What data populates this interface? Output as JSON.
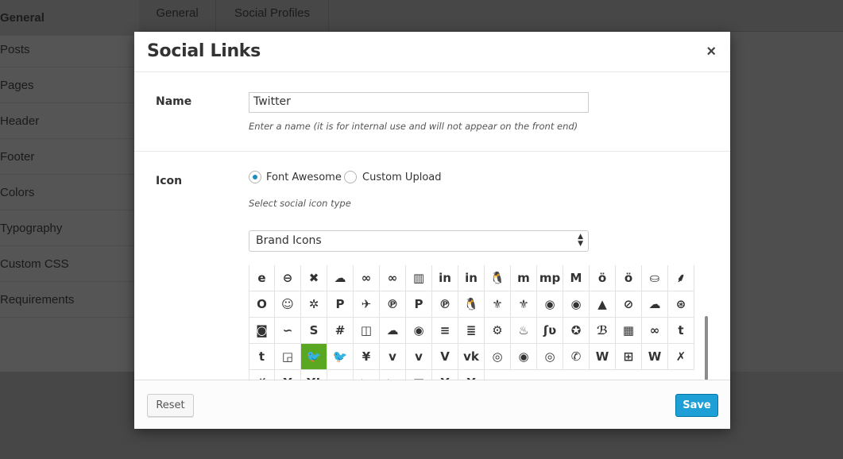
{
  "background": {
    "sidebar": [
      "General",
      "Posts",
      "Pages",
      "Header",
      "Footer",
      "Colors",
      "Typography",
      "Custom CSS",
      "Requirements"
    ],
    "tabs": [
      "General",
      "Social Profiles"
    ]
  },
  "modal": {
    "title": "Social Links",
    "close": "×",
    "name_label": "Name",
    "name_value": "Twitter",
    "name_help": "Enter a name (it is for internal use and will not appear on the front end)",
    "icon_label": "Icon",
    "radio_font_awesome": "Font Awesome",
    "radio_custom_upload": "Custom Upload",
    "icon_help": "Select social icon type",
    "icon_type_select": "Brand Icons",
    "icons": [
      "internet-explorer-icon",
      "opencart-icon",
      "joomla-icon",
      "jsfiddle-icon",
      "lastfm-icon",
      "lastfm-square-icon",
      "leanpub-icon",
      "linkedin-icon",
      "linkedin-square-icon",
      "linux-icon",
      "maxcdn-icon",
      "meanpath-icon",
      "medium-icon",
      "odnoklassniki-icon",
      "odnoklassniki-square-icon",
      "opencart-icon",
      "openid-icon",
      "opera-icon",
      "optin-monster-icon",
      "pagelines-icon",
      "paypal-icon",
      "pied-piper-icon",
      "pinterest-icon",
      "pinterest-p-icon",
      "pinterest-square-icon",
      "qq-icon",
      "rebel-icon",
      "resistance-icon",
      "reddit-icon",
      "reddit-square-icon",
      "renren-icon",
      "safari-icon",
      "soundcloud-icon",
      "sellsy-icon",
      "simplybuilt-icon",
      "skyatlas-icon",
      "skype-icon",
      "slack-icon",
      "slideshare-icon",
      "soundcloud-icon",
      "spotify-icon",
      "stack-exchange-icon",
      "stack-overflow-icon",
      "steam-icon",
      "steam-square-icon",
      "stumbleupon-icon",
      "stumbleupon-circle-icon",
      "tencent-weibo-icon",
      "trello-icon",
      "tripadvisor-icon",
      "tumblr-icon",
      "tumblr-square-icon",
      "twitch-icon",
      "twitter-icon",
      "twitter-square-icon",
      "viacoin-icon",
      "vimeo-icon",
      "vimeo-square-icon",
      "vine-icon",
      "vk-icon",
      "wechat-icon",
      "weibo-icon",
      "weixin-icon",
      "whatsapp-icon",
      "wikipedia-icon",
      "windows-icon",
      "wordpress-icon",
      "xing-icon",
      "xing-square-icon",
      "y-combinator-icon",
      "yahoo-icon",
      "yelp-icon",
      "youtube-icon",
      "youtube-play-icon",
      "youtube-square-icon",
      "yc-icon",
      "hacker-news-icon"
    ],
    "icon_glyphs": [
      "e",
      "⊖",
      "✖",
      "☁",
      "∞",
      "∞",
      "▥",
      "in",
      "in",
      "🐧",
      "m",
      "mp",
      "M",
      "ö",
      "ö",
      "⛀",
      "⸙",
      "O",
      "☺",
      "✲",
      "P",
      "✈",
      "℗",
      "P",
      "℗",
      "🐧",
      "⚜",
      "⚜",
      "◉",
      "◉",
      "▲",
      "⊘",
      "☁",
      "⊛",
      "◙",
      "∽",
      "S",
      "#",
      "◫",
      "☁",
      "◉",
      "≡",
      "≣",
      "⚙",
      "♨",
      "ʃʋ",
      "✪",
      "ℬ",
      "▦",
      "∞",
      "t",
      "t",
      "◲",
      "🐦",
      "🐦",
      "¥",
      "v",
      "v",
      "V",
      "vk",
      "◎",
      "◉",
      "◎",
      "✆",
      "W",
      "⊞",
      "W",
      "✗",
      "✗",
      "Y",
      "Y!",
      "y",
      "▶",
      "▶",
      "▣",
      "Y",
      "Y"
    ],
    "selected_icon": "twitter-icon",
    "reset_label": "Reset",
    "save_label": "Save"
  },
  "colors": {
    "selected": "#5aa822",
    "save": "#1ea0d6",
    "radio": "#1e8cbe"
  }
}
